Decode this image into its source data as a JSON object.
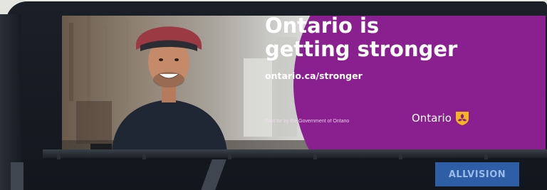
{
  "billboard": {
    "headline_line1": "Ontario is",
    "headline_line2": "getting stronger",
    "url": "ontario.ca/stronger",
    "paid_for": "Paid for by the Government of Ontario",
    "brand": "Ontario"
  },
  "structure": {
    "operator_label": "ALLVISION"
  },
  "colors": {
    "purple": "#8a1f8f",
    "trillium_gold": "#f4b51f",
    "text_white": "#ffffff",
    "frame_dark": "#161a21",
    "operator_blue": "#2e5ea6"
  },
  "icons": {
    "logo": "ontario-trillium-logo"
  }
}
